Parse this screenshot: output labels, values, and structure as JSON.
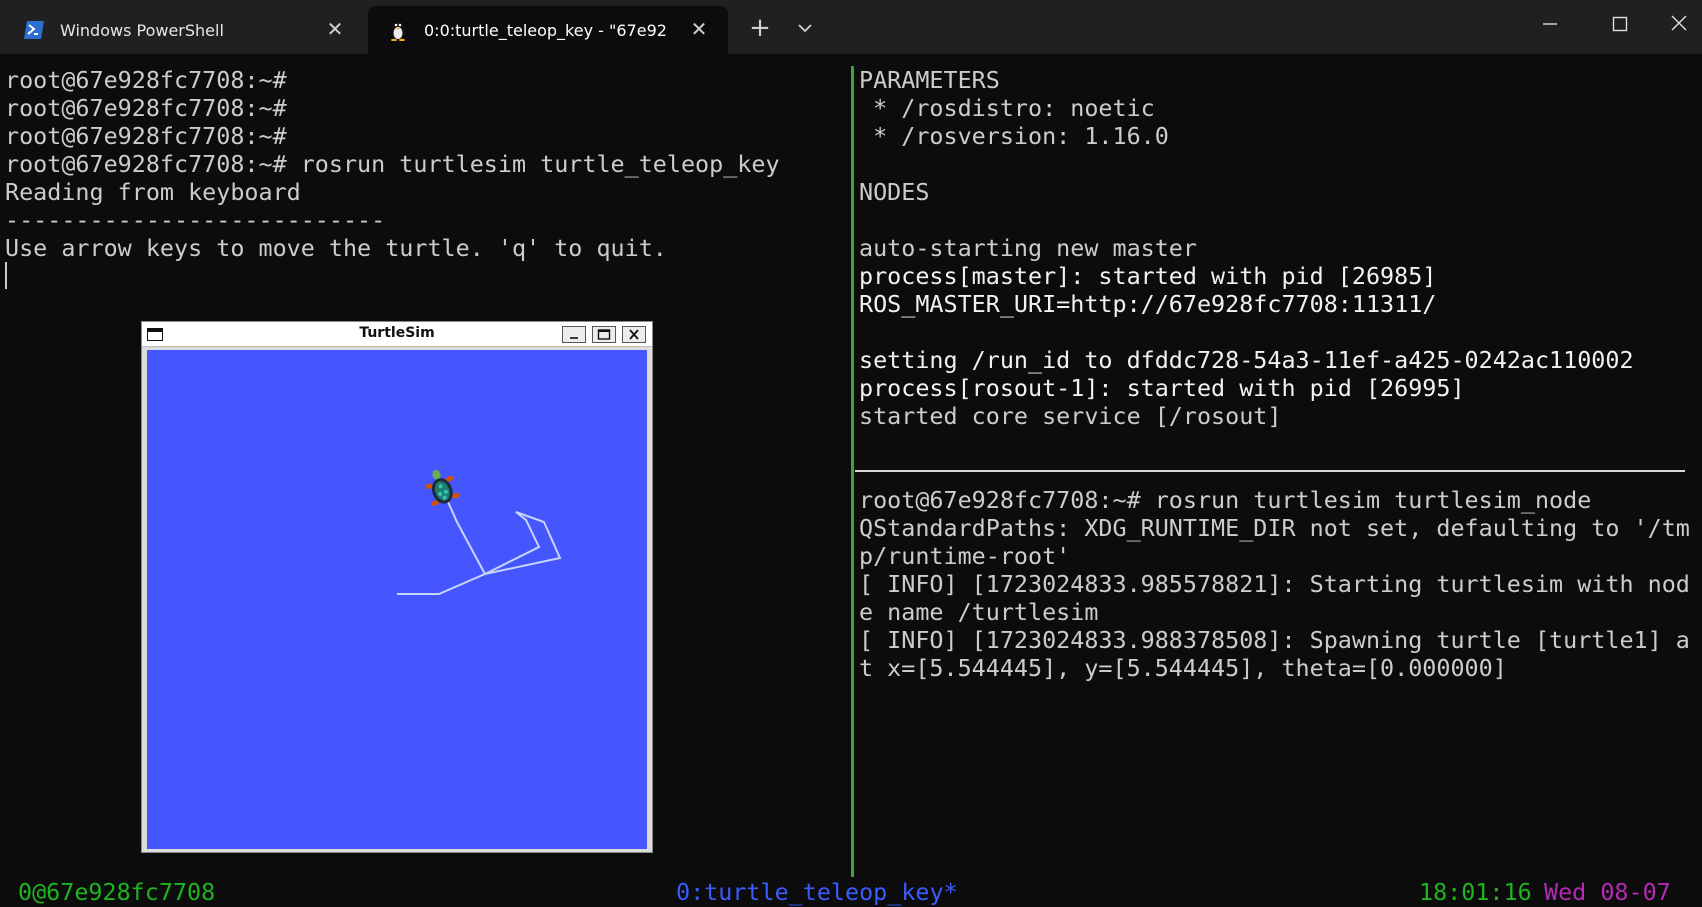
{
  "tabs": [
    {
      "label": "Windows PowerShell",
      "icon": "powershell-icon",
      "active": false
    },
    {
      "label": "0:0:turtle_teleop_key - \"67e92",
      "icon": "linux-penguin-icon",
      "active": true
    }
  ],
  "window_controls": {
    "new_tab": "+",
    "close_tab": "✕"
  },
  "left_pane": {
    "lines": [
      "root@67e928fc7708:~#",
      "root@67e928fc7708:~#",
      "root@67e928fc7708:~#",
      "root@67e928fc7708:~# rosrun turtlesim turtle_teleop_key",
      "Reading from keyboard",
      "---------------------------",
      "Use arrow keys to move the turtle. 'q' to quit."
    ]
  },
  "turtlesim": {
    "title": "TurtleSim",
    "background_color": "#4556ff",
    "path_color": "#c8d4ff"
  },
  "right_top_pane": {
    "lines": [
      {
        "text": "PARAMETERS",
        "bright": false
      },
      {
        "text": " * /rosdistro: noetic",
        "bright": false
      },
      {
        "text": " * /rosversion: 1.16.0",
        "bright": false
      },
      {
        "text": "",
        "bright": false
      },
      {
        "text": "NODES",
        "bright": false
      },
      {
        "text": "",
        "bright": false
      },
      {
        "text": "auto-starting new master",
        "bright": false
      },
      {
        "text": "process[master]: started with pid [26985]",
        "bright": true
      },
      {
        "text": "ROS_MASTER_URI=http://67e928fc7708:11311/",
        "bright": true
      },
      {
        "text": "",
        "bright": false
      },
      {
        "text": "setting /run_id to dfddc728-54a3-11ef-a425-0242ac110002",
        "bright": true
      },
      {
        "text": "process[rosout-1]: started with pid [26995]",
        "bright": true
      },
      {
        "text": "started core service [/rosout]",
        "bright": false
      }
    ]
  },
  "right_bottom_pane": {
    "lines": [
      "root@67e928fc7708:~# rosrun turtlesim turtlesim_node",
      "QStandardPaths: XDG_RUNTIME_DIR not set, defaulting to '/tm",
      "p/runtime-root'",
      "[ INFO] [1723024833.985578821]: Starting turtlesim with nod",
      "e name /turtlesim",
      "[ INFO] [1723024833.988378508]: Spawning turtle [turtle1] a",
      "t x=[5.544445], y=[5.544445], theta=[0.000000]"
    ]
  },
  "status_bar": {
    "session": "0@67e928fc7708",
    "window": "0:turtle_teleop_key*",
    "time": "18:01:16",
    "date": "Wed 08-07"
  },
  "colors": {
    "terminal_bg": "#0c0c0c",
    "titlebar_bg": "#202020",
    "pane_divider": "#3fa33f",
    "status_green": "#1fb51f",
    "status_blue": "#3a5cff",
    "status_magenta": "#b42ab4"
  }
}
